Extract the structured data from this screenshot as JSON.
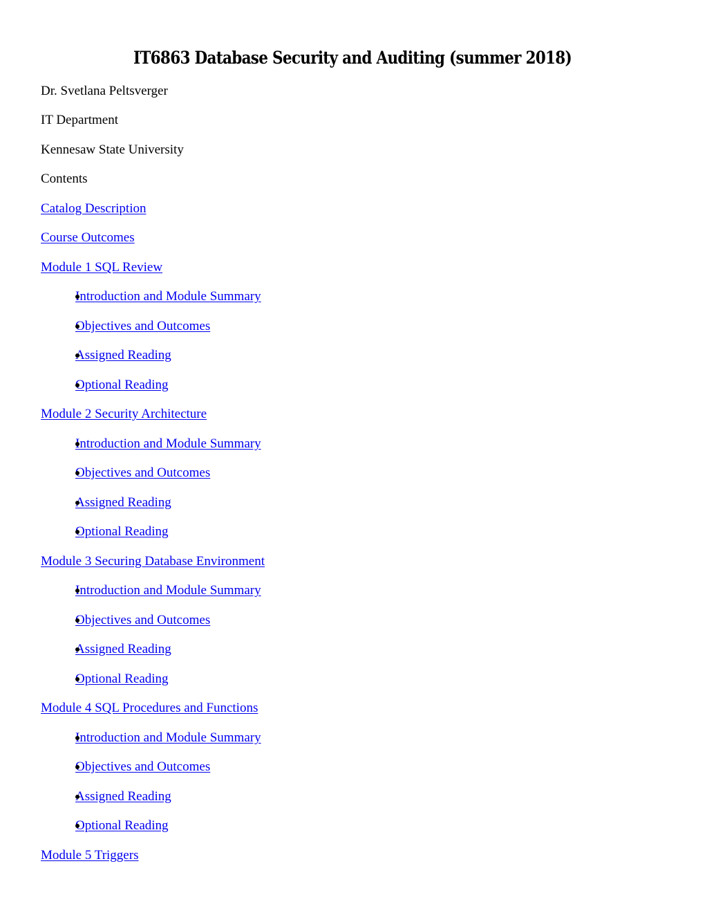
{
  "document": {
    "title": "IT6863 Database Security and Auditing (summer 2018)",
    "author": "Dr. Svetlana Peltsverger",
    "department": "IT Department",
    "university": "Kennesaw State University",
    "contents_label": "Contents",
    "link_color": "#0000ee"
  },
  "toc": {
    "top_links": [
      {
        "label": "Catalog Description"
      },
      {
        "label": "Course Outcomes"
      }
    ],
    "modules": [
      {
        "label": "Module 1 SQL Review",
        "items": [
          {
            "label": "Introduction and Module Summary"
          },
          {
            "label": "Objectives and Outcomes"
          },
          {
            "label": "Assigned Reading"
          },
          {
            "label": "Optional Reading"
          }
        ]
      },
      {
        "label": "Module 2 Security Architecture",
        "items": [
          {
            "label": "Introduction and Module Summary"
          },
          {
            "label": "Objectives and Outcomes"
          },
          {
            "label": "Assigned Reading"
          },
          {
            "label": "Optional Reading"
          }
        ]
      },
      {
        "label": "Module 3 Securing Database Environment",
        "items": [
          {
            "label": "Introduction and Module Summary"
          },
          {
            "label": "Objectives and Outcomes"
          },
          {
            "label": "Assigned Reading"
          },
          {
            "label": "Optional Reading"
          }
        ]
      },
      {
        "label": "Module 4 SQL Procedures and Functions",
        "items": [
          {
            "label": "Introduction and Module Summary"
          },
          {
            "label": "Objectives and Outcomes"
          },
          {
            "label": "Assigned Reading"
          },
          {
            "label": "Optional Reading"
          }
        ]
      },
      {
        "label": "Module 5 Triggers",
        "items": []
      }
    ]
  }
}
